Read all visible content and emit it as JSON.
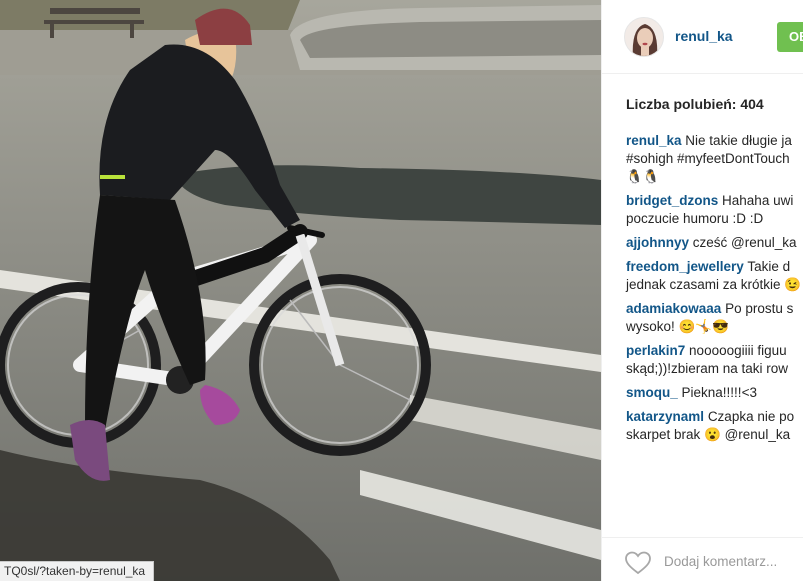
{
  "post": {
    "username": "renul_ka",
    "follow_label": "OB",
    "likes_text": "Liczba polubień: 404",
    "add_comment_placeholder": "Dodaj komentarz...",
    "status_url": "TQ0sl/?taken-by=renul_ka"
  },
  "comments": [
    {
      "user": "renul_ka",
      "lines": [
        "Nie takie długie ja",
        "#sohigh #myfeetDontTouch",
        "🐧🐧"
      ]
    },
    {
      "user": "bridget_dzons",
      "lines": [
        "Hahaha uwi",
        "poczucie humoru :D :D"
      ]
    },
    {
      "user": "ajjohnnyy",
      "lines": [
        "cześć @renul_ka"
      ]
    },
    {
      "user": "freedom_jewellery",
      "lines": [
        "Takie d",
        "jednak czasami za krótkie 😉"
      ]
    },
    {
      "user": "adamiakowaaa",
      "lines": [
        "Po prostu s",
        "wysoko! 😊🤸😎"
      ]
    },
    {
      "user": "perlakin7",
      "lines": [
        "nooooogiiii figuu",
        "skąd;))!zbieram na taki row"
      ]
    },
    {
      "user": "smoqu_",
      "lines": [
        "Piekna!!!!!<3"
      ]
    },
    {
      "user": "katarzynaml",
      "lines": [
        "Czapka nie po",
        "skarpet brak 😮 @renul_ka"
      ]
    }
  ],
  "colors": {
    "username": "#125688",
    "follow_button": "#70c050",
    "text": "#262626",
    "muted": "#999999"
  },
  "icons": {
    "like": "heart-icon"
  }
}
